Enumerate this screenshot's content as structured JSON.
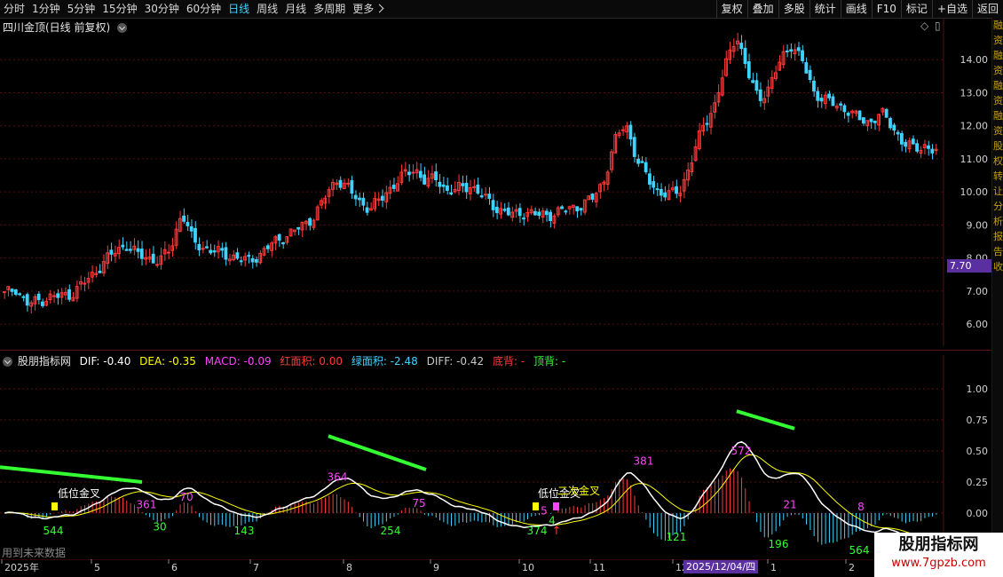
{
  "toolbar": {
    "tabs": [
      "分时",
      "1分钟",
      "5分钟",
      "15分钟",
      "30分钟",
      "60分钟",
      "日线",
      "周线",
      "月线",
      "多周期",
      "更多"
    ],
    "active_tab": "日线",
    "right_buttons": [
      "复权",
      "叠加",
      "多股",
      "统计",
      "画线",
      "F10",
      "标记",
      "+自选",
      "返回"
    ]
  },
  "main_chart": {
    "title": "四川金顶(日线 前复权)",
    "y_ticks": [
      "14.00",
      "13.00",
      "12.00",
      "11.00",
      "10.00",
      "9.00",
      "8.00",
      "7.00",
      "6.00"
    ],
    "current_price": "7.70"
  },
  "indicator": {
    "name": "股朋指标网",
    "dif": "DIF: -0.40",
    "dea": "DEA: -0.35",
    "macd": "MACD: -0.09",
    "red_area": "红面积: 0.00",
    "green_area": "绿面积: -2.48",
    "diff": "DIFF: -0.42",
    "bottom_div": "底背: -",
    "top_div": "顶背: -",
    "y_ticks": [
      "1.00",
      "0.75",
      "0.50",
      "0.25",
      "0.00"
    ],
    "annotations": [
      "低位金叉",
      "低位金叉",
      "二次金叉"
    ],
    "bar_labels": [
      "544",
      "361",
      "70",
      "30",
      "143",
      "364",
      "75",
      "254",
      "374",
      "4",
      "5",
      "381",
      "121",
      "572",
      "21",
      "196",
      "8",
      "564"
    ]
  },
  "x_axis": {
    "labels": [
      "2025年",
      "5",
      "6",
      "7",
      "8",
      "9",
      "10",
      "11",
      "12",
      "1",
      "2"
    ],
    "selected_date": "2025/12/04/四"
  },
  "footer_note": "用到未来数据",
  "watermark": {
    "line1": "股朋指标网",
    "line2": "www.7gpzb.com"
  },
  "right_column_text": [
    "融",
    "资",
    "融",
    "资",
    "融",
    "资",
    "融",
    "资",
    "股",
    "权",
    "转",
    "让",
    "分",
    "析",
    "报",
    "告",
    "收"
  ],
  "colors": {
    "up": "#ff3b3b",
    "down": "#3fd3ff",
    "dif": "#ffffff",
    "dea": "#ffff00",
    "accent": "#5a2fa0"
  },
  "chart_data": {
    "type": "candlestick",
    "ohlc_approx": [
      6.9,
      7.1,
      6.6,
      6.7,
      6.8,
      6.85,
      6.9,
      7.2,
      7.5,
      7.9,
      8.2,
      8.4,
      8.1,
      8.0,
      7.9,
      8.3,
      9.4,
      8.5,
      8.3,
      8.2,
      8.1,
      8.0,
      7.9,
      8.1,
      8.4,
      8.6,
      8.8,
      9.0,
      9.3,
      9.9,
      10.4,
      10.1,
      9.7,
      9.5,
      9.8,
      10.2,
      10.5,
      10.7,
      10.3,
      10.4,
      10.0,
      10.1,
      10.2,
      9.9,
      9.6,
      9.4,
      9.3,
      9.4,
      9.3,
      9.3,
      9.4,
      9.5,
      9.6,
      9.8,
      10.3,
      11.5,
      12.1,
      11.0,
      10.4,
      10.0,
      9.9,
      10.1,
      11.0,
      12.0,
      12.6,
      13.8,
      14.8,
      13.6,
      12.8,
      13.2,
      14.0,
      14.5,
      13.9,
      13.0,
      12.8,
      12.6,
      12.5,
      12.2,
      12.1,
      12.4,
      12.0,
      11.5,
      11.3,
      11.4,
      11.2
    ],
    "macd_ylim": [
      -0.3,
      1.2
    ]
  }
}
